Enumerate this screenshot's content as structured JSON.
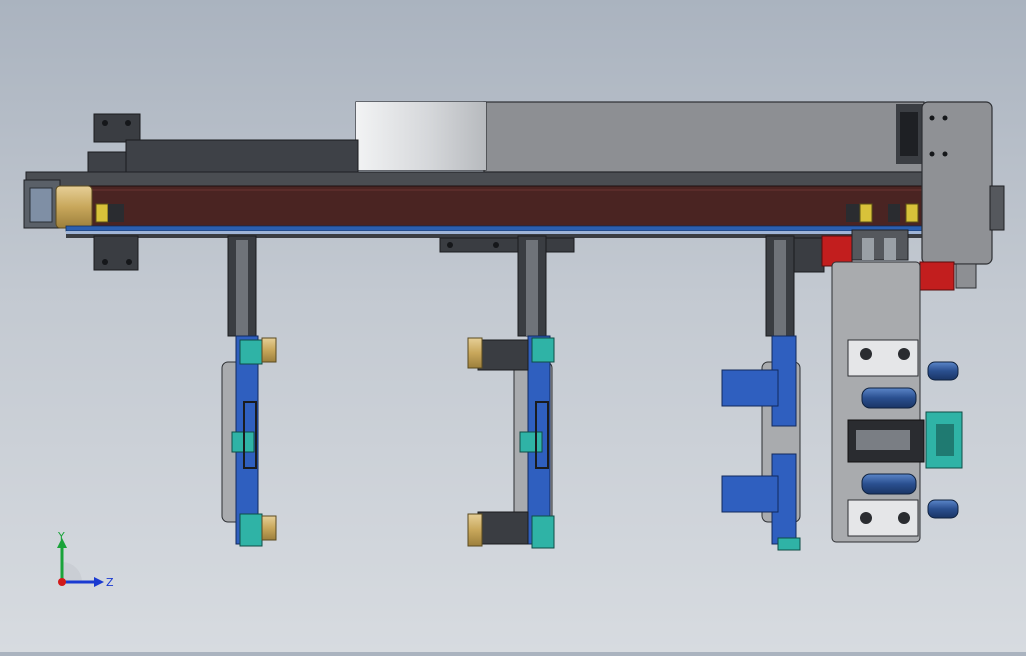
{
  "viewport": {
    "background_top": "#aab3bf",
    "background_bottom": "#d7dbe0"
  },
  "triad": {
    "y_label": "Y",
    "z_label": "Z",
    "x_color": "#d11a1a",
    "y_color": "#1aa33a",
    "z_color": "#1a3ad1"
  },
  "colors": {
    "frame_dark": "#3a3d42",
    "belt_brown": "#4a2422",
    "housing_gray": "#8d8f93",
    "roller_light": "#cfd2d6",
    "rail_blue": "#2b5fb0",
    "gripper_blue": "#2f5fbf",
    "teal_block": "#2fb3a6",
    "brass": "#c2a13a",
    "red_accent": "#c21e1e",
    "cylinder_blue": "#2a4f8f",
    "plate_gray": "#a9abae"
  },
  "model": {
    "name_icon": "gantry-loader-assembly-icon",
    "gripper_stations": 3
  }
}
